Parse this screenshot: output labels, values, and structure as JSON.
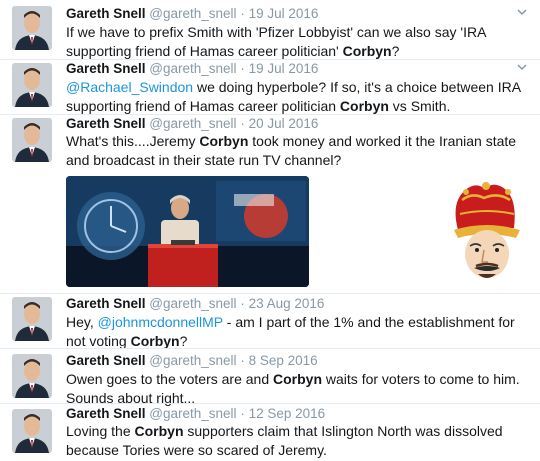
{
  "tweets": [
    {
      "name": "Gareth Snell",
      "handle": "@gareth_snell",
      "sep": "·",
      "date": "19 Jul 2016",
      "parts": [
        {
          "t": "If we have to prefix Smith with 'Pfizer Lobbyist' can we also say 'IRA supporting friend of Hamas career politician' "
        },
        {
          "t": "Corbyn",
          "bold": true
        },
        {
          "t": "?"
        }
      ]
    },
    {
      "name": "Gareth Snell",
      "handle": "@gareth_snell",
      "sep": "·",
      "date": "19 Jul 2016",
      "parts": [
        {
          "t": "@Rachael_Swindon",
          "mention": true
        },
        {
          "t": " we doing hyperbole? If so, it's a choice between IRA supporting friend of Hamas career politician "
        },
        {
          "t": "Corbyn",
          "bold": true
        },
        {
          "t": " vs Smith."
        }
      ]
    },
    {
      "name": "Gareth Snell",
      "handle": "@gareth_snell",
      "sep": "·",
      "date": "20 Jul 2016",
      "parts": [
        {
          "t": "What's this....Jeremy "
        },
        {
          "t": "Corbyn",
          "bold": true
        },
        {
          "t": " took money and worked it the Iranian state and broadcast in their state run TV channel?"
        }
      ]
    },
    {
      "name": "Gareth Snell",
      "handle": "@gareth_snell",
      "sep": "·",
      "date": "23 Aug 2016",
      "parts": [
        {
          "t": "Hey, "
        },
        {
          "t": "@johnmcdonnellMP",
          "mention": true
        },
        {
          "t": " - am I part of the 1% and the establishment for not voting "
        },
        {
          "t": "Corbyn",
          "bold": true
        },
        {
          "t": "?"
        }
      ]
    },
    {
      "name": "Gareth Snell",
      "handle": "@gareth_snell",
      "sep": "·",
      "date": "8 Sep 2016",
      "parts": [
        {
          "t": "Owen goes to the voters are and "
        },
        {
          "t": "Corbyn",
          "bold": true
        },
        {
          "t": " waits for voters to come to him. Sounds about right..."
        }
      ]
    },
    {
      "name": "Gareth Snell",
      "handle": "@gareth_snell",
      "sep": "·",
      "date": "12 Sep 2016",
      "parts": [
        {
          "t": "Loving the "
        },
        {
          "t": "Corbyn",
          "bold": true
        },
        {
          "t": " supporters claim that Islington North was dissolved because Tories were so scared of Jeremy."
        }
      ]
    }
  ],
  "colors": {
    "name": "#14171a",
    "meta": "#8899a6",
    "mention": "#1b95e0",
    "divider": "#e6ecf0",
    "stage_red": "#c0201e",
    "screen_blue": "#2a5f8f"
  },
  "icons": {
    "caret": "chevron-down-icon",
    "avatar": "profile-photo",
    "jester": "jester-head-image"
  }
}
